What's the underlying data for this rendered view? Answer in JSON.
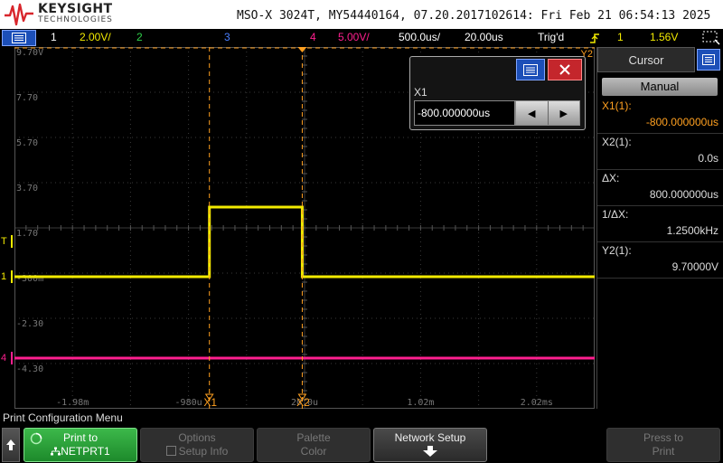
{
  "header": {
    "brand": "KEYSIGHT",
    "brand_sub": "TECHNOLOGIES",
    "model_line": "MSO-X 3024T, MY54440164, 07.20.2017102614: Fri Feb 21 06:54:13 2025"
  },
  "status_bar": {
    "ch1_label": "1",
    "ch1_scale": "2.00V/",
    "ch2_label": "2",
    "ch3_label": "3",
    "ch4_label": "4",
    "ch4_scale": "5.00V/",
    "timebase": "500.0us/",
    "delay": "20.00us",
    "trigger_state": "Trig'd",
    "trigger_source": "1",
    "trigger_level": "1.56V"
  },
  "graticule": {
    "y_labels": [
      "9.70V",
      "7.70",
      "5.70",
      "3.70",
      "1.70",
      "-300m",
      "-2.30",
      "-4.30"
    ],
    "x_labels": [
      "-1.98m",
      "-980u",
      "20.0u",
      "1.02m",
      "2.02ms"
    ],
    "trig_marker": "T",
    "ch1_marker": "1",
    "ch4_marker": "4",
    "cursor_x1_tag": "X1",
    "cursor_x2_tag": "X2",
    "cursor_y2_tag": "Y2"
  },
  "traces": {
    "ch1_color": "#f2ea00",
    "ch4_color": "#ff1f8f",
    "ch1_low_v": -0.3,
    "ch1_high_v": 3.3,
    "ch1_pulse_start_ms": -0.8,
    "ch1_pulse_end_ms": 0.0,
    "ch4_v": -3.5,
    "x1_ms": -0.8,
    "x2_ms": 0.0
  },
  "cursor_panel": {
    "title": "Cursor",
    "mode": "Manual",
    "rows": [
      {
        "label": "X1(1):",
        "value": "-800.000000us",
        "color": "#ffa020"
      },
      {
        "label": "X2(1):",
        "value": "0.0s",
        "color": "#dddddd"
      },
      {
        "label": "ΔX:",
        "value": "800.000000us",
        "color": "#dddddd"
      },
      {
        "label": "1/ΔX:",
        "value": "1.2500kHz",
        "color": "#dddddd"
      },
      {
        "label": "Y2(1):",
        "value": "9.70000V",
        "color": "#dddddd"
      }
    ]
  },
  "popup": {
    "label": "X1",
    "value": "-800.000000us"
  },
  "softkeys": {
    "menu_title": "Print Configuration Menu",
    "print_to_line1": "Print to",
    "print_to_line2": "NETPRT1",
    "options_line1": "Options",
    "options_line2": "Setup Info",
    "palette_line1": "Palette",
    "palette_line2": "Color",
    "network_line1": "Network Setup",
    "press_line1": "Press to",
    "press_line2": "Print"
  }
}
